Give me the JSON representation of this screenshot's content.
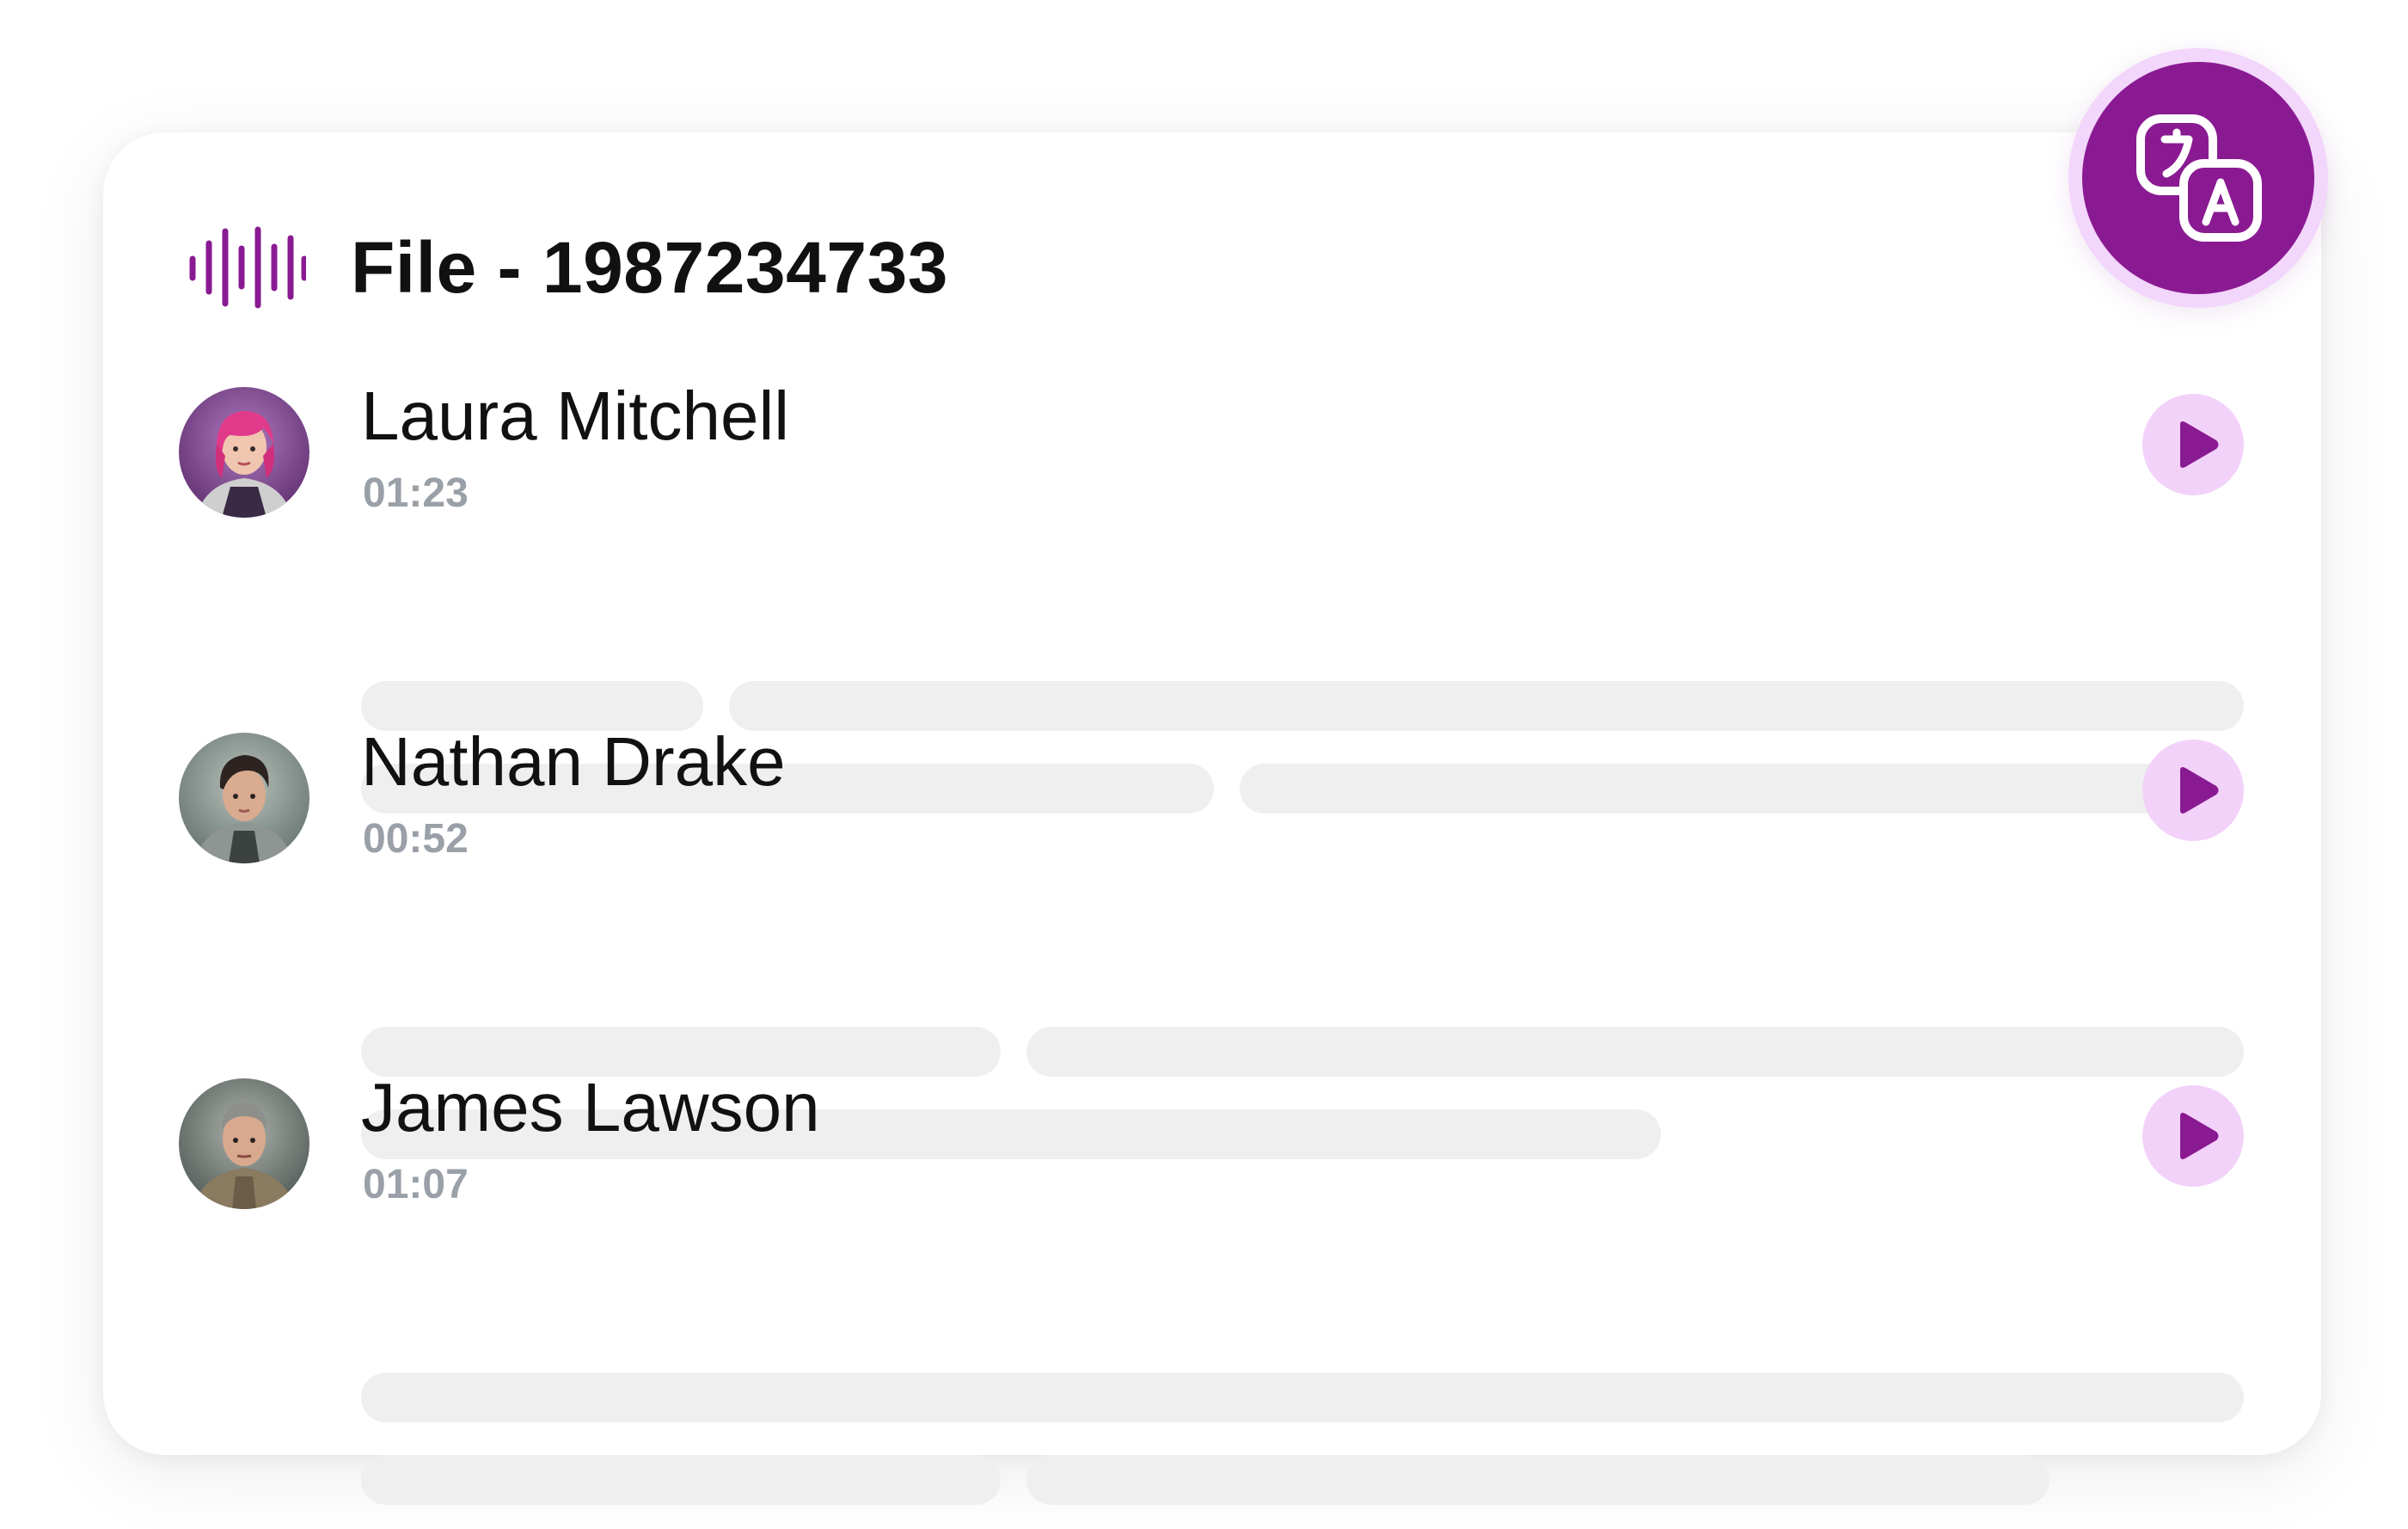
{
  "file": {
    "title": "File - 1987234733"
  },
  "colors": {
    "accent": "#8a1a92",
    "accent_light": "#f3d2fa",
    "text_primary": "#111111",
    "text_muted": "#9aa0a8",
    "skeleton": "#efefef"
  },
  "icons": {
    "header": "audio-waveform-icon",
    "fab": "translate-icon",
    "entry_action": "play-icon"
  },
  "entries": [
    {
      "name": "Laura Mitchell",
      "time": "01:23"
    },
    {
      "name": "Nathan Drake",
      "time": "00:52"
    },
    {
      "name": "James Lawson",
      "time": "01:07"
    }
  ]
}
